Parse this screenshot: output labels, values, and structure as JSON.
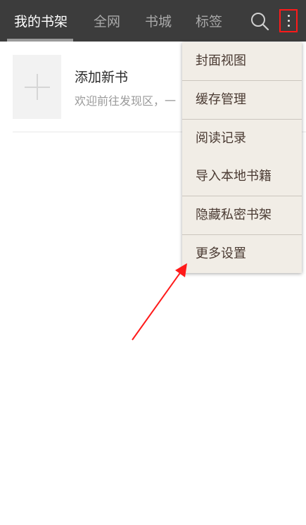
{
  "tabs": [
    {
      "label": "我的书架",
      "active": true
    },
    {
      "label": "全网",
      "active": false
    },
    {
      "label": "书城",
      "active": false
    },
    {
      "label": "标签",
      "active": false
    }
  ],
  "toolbar": {
    "search_icon": "search-icon",
    "more_icon": "more-vertical-icon"
  },
  "add_book": {
    "title": "添加新书",
    "description": "欢迎前往发现区，一"
  },
  "menu": {
    "items": [
      "封面视图",
      "缓存管理",
      "阅读记录",
      "导入本地书籍",
      "隐藏私密书架",
      "更多设置"
    ]
  },
  "colors": {
    "topbar": "#3c3c3c",
    "menu_bg": "#f1ede6",
    "highlight": "#ff1a1a"
  }
}
